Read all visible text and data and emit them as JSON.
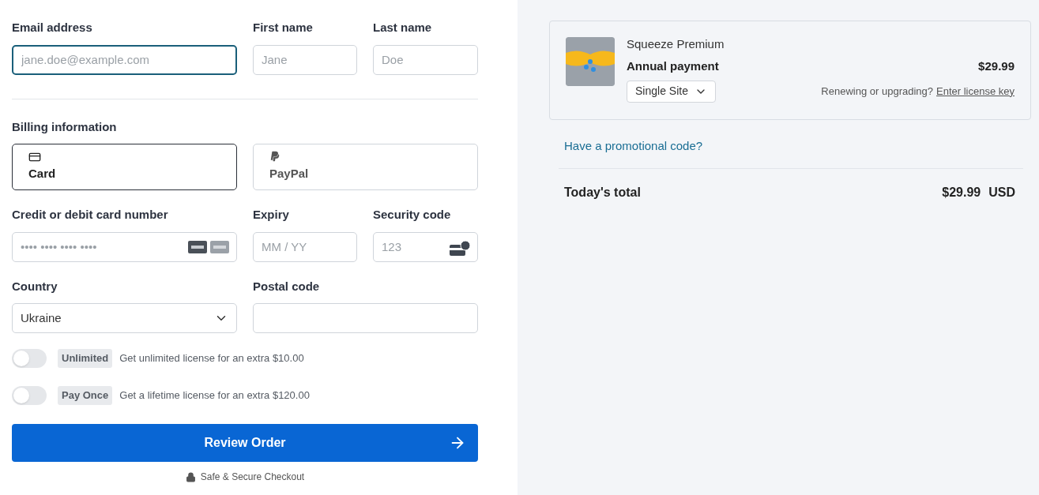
{
  "contact": {
    "email": {
      "label": "Email address",
      "placeholder": "jane.doe@example.com",
      "focused": true
    },
    "first_name": {
      "label": "First name",
      "placeholder": "Jane"
    },
    "last_name": {
      "label": "Last name",
      "placeholder": "Doe"
    }
  },
  "billing": {
    "title": "Billing information",
    "methods": [
      {
        "kind": "card",
        "label": "Card",
        "selected": true
      },
      {
        "kind": "paypal",
        "label": "PayPal",
        "selected": false
      }
    ]
  },
  "card_number": {
    "label": "Credit or debit card number",
    "placeholder": "•••• •••• •••• ••••"
  },
  "expiry": {
    "label": "Expiry",
    "placeholder": "MM / YY"
  },
  "security_code": {
    "label": "Security code",
    "placeholder": "123"
  },
  "country": {
    "label": "Country",
    "value": "Ukraine"
  },
  "postal_code": {
    "label": "Postal code"
  },
  "options": [
    {
      "badge": "Unlimited",
      "text": "Get unlimited license for an extra $10.00",
      "on": false
    },
    {
      "badge": "Pay Once",
      "text": "Get a lifetime license for an extra $120.00",
      "on": false
    }
  ],
  "review_button": "Review Order",
  "secure_note": "Safe & Secure Checkout",
  "order": {
    "product": "Squeeze Premium",
    "plan": "Annual payment",
    "price": "$29.99",
    "site_option": "Single Site",
    "renew_text": "Renewing or upgrading?",
    "renew_link": "Enter license key"
  },
  "promo_link": "Have a promotional code?",
  "total": {
    "label": "Today's total",
    "amount": "$29.99",
    "currency": "USD"
  }
}
